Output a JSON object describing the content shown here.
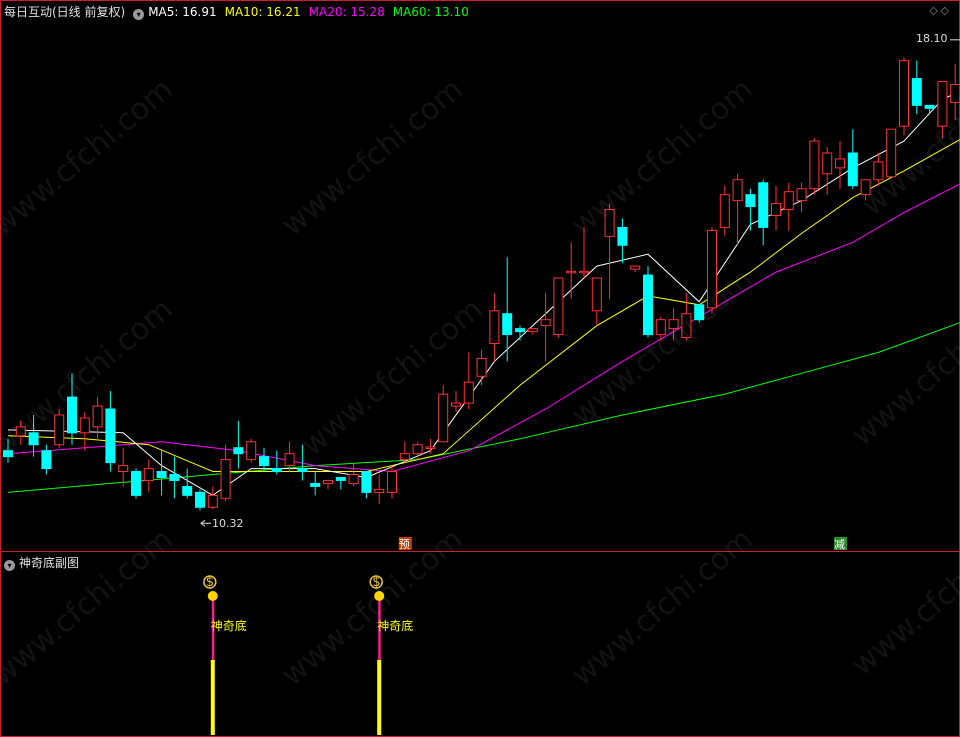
{
  "header": {
    "title": "每日互动(日线 前复权)",
    "ma": [
      {
        "label": "MA5: 16.91",
        "color": "#ffffff"
      },
      {
        "label": "MA10: 16.21",
        "color": "#ffff00"
      },
      {
        "label": "MA20: 15.28",
        "color": "#ff00ff"
      },
      {
        "label": "MA60: 13.10",
        "color": "#00ff00"
      }
    ]
  },
  "subchart": {
    "title": "神奇底副图",
    "signal_label": "神奇底"
  },
  "watermark": "www.cfchi.com",
  "colors": {
    "up": "#ff3232",
    "down": "#00ffff",
    "frame": "#c8202e",
    "ma5": "#ffffff",
    "ma10": "#ffff00",
    "ma20": "#ff00ff",
    "ma60": "#00ff00"
  },
  "chart_data": {
    "type": "candlestick",
    "ylim": [
      9.8,
      18.5
    ],
    "annotations": {
      "high_label": "18.10",
      "low_label": "10.32",
      "marker_yu": "预",
      "marker_jian": "减"
    },
    "candles": [
      [
        11.3,
        11.5,
        11.1,
        11.2
      ],
      [
        11.55,
        11.8,
        11.4,
        11.7
      ],
      [
        11.6,
        11.9,
        11.2,
        11.4
      ],
      [
        11.3,
        11.4,
        10.9,
        11.0
      ],
      [
        11.4,
        12.0,
        11.35,
        11.9
      ],
      [
        12.2,
        12.6,
        11.4,
        11.6
      ],
      [
        11.6,
        11.95,
        11.3,
        11.85
      ],
      [
        11.7,
        12.2,
        11.5,
        12.05
      ],
      [
        12.0,
        12.3,
        10.95,
        11.1
      ],
      [
        10.95,
        11.35,
        10.7,
        11.05
      ],
      [
        10.95,
        11.0,
        10.5,
        10.55
      ],
      [
        10.8,
        11.15,
        10.6,
        11.0
      ],
      [
        10.95,
        11.3,
        10.55,
        10.85
      ],
      [
        10.9,
        11.2,
        10.5,
        10.8
      ],
      [
        10.7,
        11.0,
        10.5,
        10.55
      ],
      [
        10.6,
        10.65,
        10.3,
        10.35
      ],
      [
        10.35,
        10.7,
        10.32,
        10.55
      ],
      [
        10.5,
        11.4,
        10.45,
        11.15
      ],
      [
        11.35,
        11.8,
        11.0,
        11.25
      ],
      [
        11.15,
        11.5,
        11.1,
        11.45
      ],
      [
        11.2,
        11.35,
        10.95,
        11.05
      ],
      [
        11.0,
        11.3,
        10.9,
        10.95
      ],
      [
        11.05,
        11.45,
        10.95,
        11.25
      ],
      [
        11.0,
        11.4,
        10.8,
        10.95
      ],
      [
        10.75,
        10.95,
        10.55,
        10.7
      ],
      [
        10.75,
        10.8,
        10.65,
        10.8
      ],
      [
        10.85,
        10.8,
        10.65,
        10.8
      ],
      [
        10.75,
        11.1,
        10.7,
        10.9
      ],
      [
        10.95,
        10.95,
        10.5,
        10.6
      ],
      [
        10.6,
        10.9,
        10.4,
        10.65
      ],
      [
        10.6,
        11.05,
        10.5,
        10.95
      ],
      [
        11.15,
        11.45,
        11.1,
        11.25
      ],
      [
        11.25,
        11.45,
        11.15,
        11.4
      ],
      [
        11.35,
        11.5,
        11.25,
        11.35
      ],
      [
        11.45,
        12.4,
        11.45,
        12.25
      ],
      [
        12.05,
        12.3,
        11.95,
        12.1
      ],
      [
        12.1,
        12.95,
        12.0,
        12.45
      ],
      [
        12.55,
        13.0,
        12.4,
        12.85
      ],
      [
        13.1,
        13.95,
        12.8,
        13.65
      ],
      [
        13.6,
        14.55,
        12.8,
        13.25
      ],
      [
        13.35,
        13.4,
        13.15,
        13.3
      ],
      [
        13.3,
        13.35,
        13.25,
        13.35
      ],
      [
        13.4,
        13.95,
        12.8,
        13.5
      ],
      [
        13.25,
        13.8,
        13.2,
        14.2
      ],
      [
        14.3,
        14.8,
        13.85,
        14.3
      ],
      [
        14.3,
        15.05,
        14.2,
        14.3
      ],
      [
        13.65,
        14.1,
        13.4,
        14.2
      ],
      [
        14.9,
        15.45,
        13.85,
        15.35
      ],
      [
        15.05,
        15.2,
        14.45,
        14.75
      ],
      [
        14.35,
        14.4,
        14.3,
        14.4
      ],
      [
        14.25,
        14.4,
        13.2,
        13.25
      ],
      [
        13.25,
        13.55,
        13.15,
        13.5
      ],
      [
        13.35,
        13.7,
        13.15,
        13.5
      ],
      [
        13.2,
        13.95,
        13.15,
        13.6
      ],
      [
        13.75,
        13.75,
        13.45,
        13.5
      ],
      [
        13.7,
        15.05,
        13.6,
        15.0
      ],
      [
        15.05,
        15.75,
        14.9,
        15.6
      ],
      [
        15.5,
        15.95,
        14.75,
        15.85
      ],
      [
        15.6,
        15.7,
        15.0,
        15.4
      ],
      [
        15.8,
        15.85,
        14.75,
        15.05
      ],
      [
        15.25,
        15.75,
        15.0,
        15.45
      ],
      [
        15.35,
        15.8,
        15.0,
        15.65
      ],
      [
        15.5,
        15.8,
        15.3,
        15.7
      ],
      [
        15.7,
        16.55,
        15.6,
        16.5
      ],
      [
        15.95,
        16.4,
        15.6,
        16.3
      ],
      [
        16.05,
        16.5,
        15.7,
        16.2
      ],
      [
        16.3,
        16.7,
        15.7,
        15.75
      ],
      [
        15.6,
        15.7,
        15.5,
        15.85
      ],
      [
        15.85,
        16.3,
        15.75,
        16.15
      ],
      [
        15.9,
        16.6,
        15.9,
        16.7
      ],
      [
        16.75,
        17.9,
        16.6,
        17.85
      ],
      [
        17.55,
        17.85,
        16.95,
        17.1
      ],
      [
        17.1,
        17.1,
        16.95,
        17.05
      ],
      [
        16.75,
        17.4,
        16.55,
        17.5
      ],
      [
        17.15,
        17.8,
        16.85,
        17.45
      ],
      [
        17.65,
        18.1,
        16.7,
        18.0
      ]
    ],
    "ma5": [
      [
        0,
        11.65
      ],
      [
        9,
        11.6
      ],
      [
        12,
        11.05
      ],
      [
        16,
        10.55
      ],
      [
        19,
        11.0
      ],
      [
        24,
        11.0
      ],
      [
        28,
        10.85
      ],
      [
        33,
        11.3
      ],
      [
        38,
        12.8
      ],
      [
        42,
        13.6
      ],
      [
        46,
        14.4
      ],
      [
        50,
        14.6
      ],
      [
        54,
        13.8
      ],
      [
        58,
        15.1
      ],
      [
        62,
        15.5
      ],
      [
        66,
        16.05
      ],
      [
        70,
        16.5
      ],
      [
        73,
        17.2
      ],
      [
        75,
        17.4
      ]
    ],
    "ma10": [
      [
        0,
        11.55
      ],
      [
        6,
        11.5
      ],
      [
        11,
        11.4
      ],
      [
        16,
        10.95
      ],
      [
        22,
        10.95
      ],
      [
        28,
        10.95
      ],
      [
        34,
        11.25
      ],
      [
        40,
        12.4
      ],
      [
        46,
        13.4
      ],
      [
        50,
        13.9
      ],
      [
        54,
        13.75
      ],
      [
        58,
        14.3
      ],
      [
        62,
        14.95
      ],
      [
        66,
        15.55
      ],
      [
        70,
        16.0
      ],
      [
        75,
        16.6
      ]
    ],
    "ma20": [
      [
        0,
        11.25
      ],
      [
        6,
        11.35
      ],
      [
        12,
        11.45
      ],
      [
        18,
        11.3
      ],
      [
        24,
        11.05
      ],
      [
        30,
        10.95
      ],
      [
        36,
        11.3
      ],
      [
        42,
        12.0
      ],
      [
        48,
        12.8
      ],
      [
        52,
        13.3
      ],
      [
        56,
        13.8
      ],
      [
        60,
        14.3
      ],
      [
        66,
        14.8
      ],
      [
        70,
        15.3
      ],
      [
        75,
        15.85
      ]
    ],
    "ma60": [
      [
        0,
        10.6
      ],
      [
        8,
        10.75
      ],
      [
        16,
        10.9
      ],
      [
        24,
        11.05
      ],
      [
        32,
        11.15
      ],
      [
        40,
        11.5
      ],
      [
        48,
        11.9
      ],
      [
        56,
        12.25
      ],
      [
        62,
        12.6
      ],
      [
        68,
        12.95
      ],
      [
        75,
        13.5
      ]
    ],
    "signal_bars": [
      16,
      29
    ]
  }
}
